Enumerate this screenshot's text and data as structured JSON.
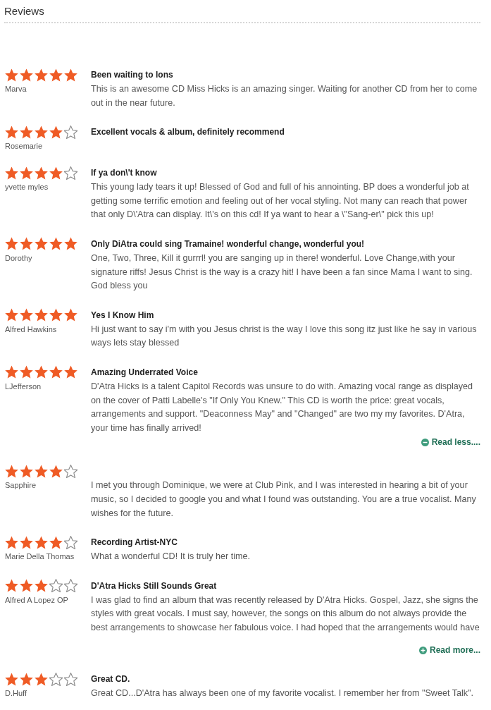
{
  "heading": "Reviews",
  "reviews": [
    {
      "stars": 5,
      "author": "Marva",
      "title": "Been waiting to lons",
      "body": "This is an awesome CD Miss Hicks is an amazing singer. Waiting for another CD from her to come out in the near future."
    },
    {
      "stars": 4,
      "author": "Rosemarie",
      "title": "Excellent vocals & album, definitely recommend"
    },
    {
      "stars": 4,
      "author": "yvette myles",
      "title": "If ya don\\'t know",
      "body": "This young lady tears it up! Blessed of God and full of his annointing. BP does a wonderful job at getting some terrific emotion and feeling out of her vocal styling. Not many can reach that power that only D\\'Atra can display. It\\'s on this cd! If ya want to hear a \\\"Sang-er\\\" pick this up!"
    },
    {
      "stars": 5,
      "author": "Dorothy",
      "title": "Only DiAtra could sing Tramaine! wonderful change, wonderful you!",
      "body": "One, Two, Three, Kill it gurrrl! you are sanging up in there! wonderful. Love Change,with your signature riffs! Jesus Christ is the way is a crazy hit! I have been a fan since Mama I want to sing. God bless you"
    },
    {
      "stars": 5,
      "author": "Alfred Hawkins",
      "title": "Yes I Know Him",
      "body": "Hi just want to say i'm with you Jesus christ is the way I love this song itz just like he say in various ways lets stay blessed"
    },
    {
      "stars": 5,
      "author": "LJefferson",
      "title": "Amazing Underrated Voice",
      "body": "D'Atra Hicks is a talent Capitol Records was unsure to do with. Amazing vocal range as displayed on the cover of Patti Labelle's \"If Only You Knew.\" This CD is worth the price: great vocals, arrangements and support. \"Deaconness May\" and \"Changed\" are two my my favorites. D'Atra, your time has finally arrived!",
      "toggle": {
        "kind": "collapse",
        "label": "Read less...."
      }
    },
    {
      "stars": 4,
      "author": "Sapphire",
      "body": "I met you through Dominique, we were at Club Pink, and I was interested in hearing a bit of your music, so I decided to google you and what I found was outstanding. You are a true vocalist. Many wishes for the future."
    },
    {
      "stars": 4,
      "author": "Marie Della Thomas",
      "title": "Recording Artist-NYC",
      "body": "What a wonderful CD! It is truly her time."
    },
    {
      "stars": 3,
      "author": "Alfred A Lopez OP",
      "title": "D'Atra Hicks Still Sounds Great",
      "body": "I was glad to find an album that was recently released by D'Atra Hicks. Gospel, Jazz, she signs the styles with great vocals. I must say, however, the songs on this album do not always provide the best arrangements to showcase her fabulous voice. I had hoped that the arrangements would have",
      "toggle": {
        "kind": "expand",
        "label": "Read more..."
      }
    },
    {
      "stars": 3,
      "author": "D.Huff",
      "title": "Great CD.",
      "body": "Great CD...D'Atra has always been one of my favorite vocalist. I remember her from \"Sweet Talk\"."
    }
  ]
}
